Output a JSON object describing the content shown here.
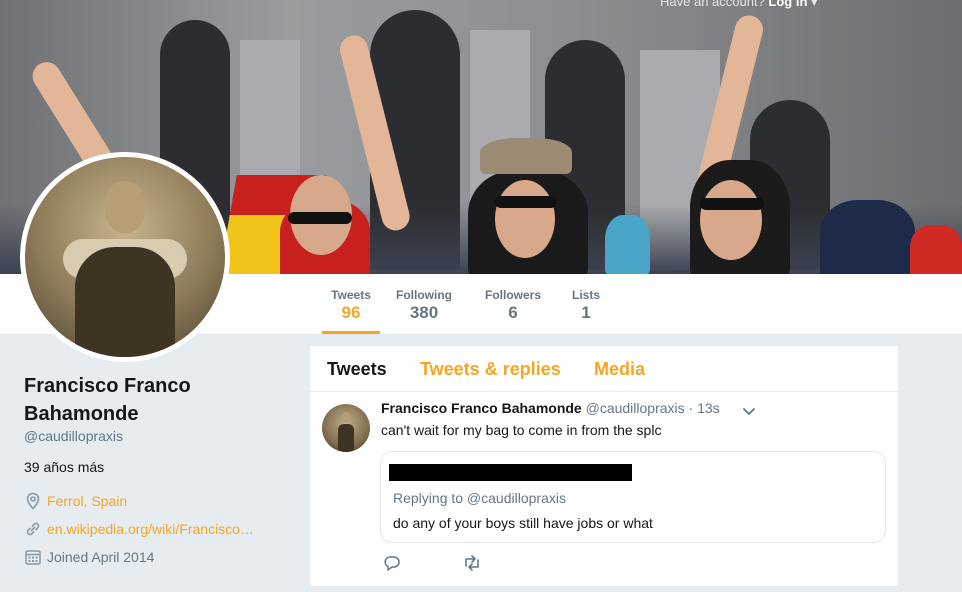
{
  "header": {
    "login_prompt": "Have an account?",
    "login_link": "Log in"
  },
  "nav": {
    "stats": [
      {
        "label": "Tweets",
        "value": "96"
      },
      {
        "label": "Following",
        "value": "380"
      },
      {
        "label": "Followers",
        "value": "6"
      },
      {
        "label": "Lists",
        "value": "1"
      }
    ]
  },
  "profile": {
    "name_line1": "Francisco Franco",
    "name_line2": "Bahamonde",
    "screen_name": "@caudillopraxis",
    "bio": "39 años más",
    "location": "Ferrol, Spain",
    "url": "en.wikipedia.org/wiki/Francisco…",
    "joined": "Joined April 2014"
  },
  "timeline": {
    "tabs": [
      "Tweets",
      "Tweets & replies",
      "Media"
    ]
  },
  "tweet": {
    "author_name": "Francisco Franco Bahamonde",
    "author_handle": "@caudillopraxis",
    "time": "· 13s",
    "text": "can't wait for my bag to come in from the splc",
    "quote": {
      "replying_to": "Replying to @caudillopraxis",
      "text": "do any of your boys still have jobs or what"
    }
  },
  "colors": {
    "accent": "#f5a623",
    "muted": "#657786",
    "background": "#e6ecf0"
  },
  "icons": [
    "location-icon",
    "link-icon",
    "calendar-icon",
    "chevron-down-icon",
    "reply-icon",
    "retweet-icon"
  ]
}
